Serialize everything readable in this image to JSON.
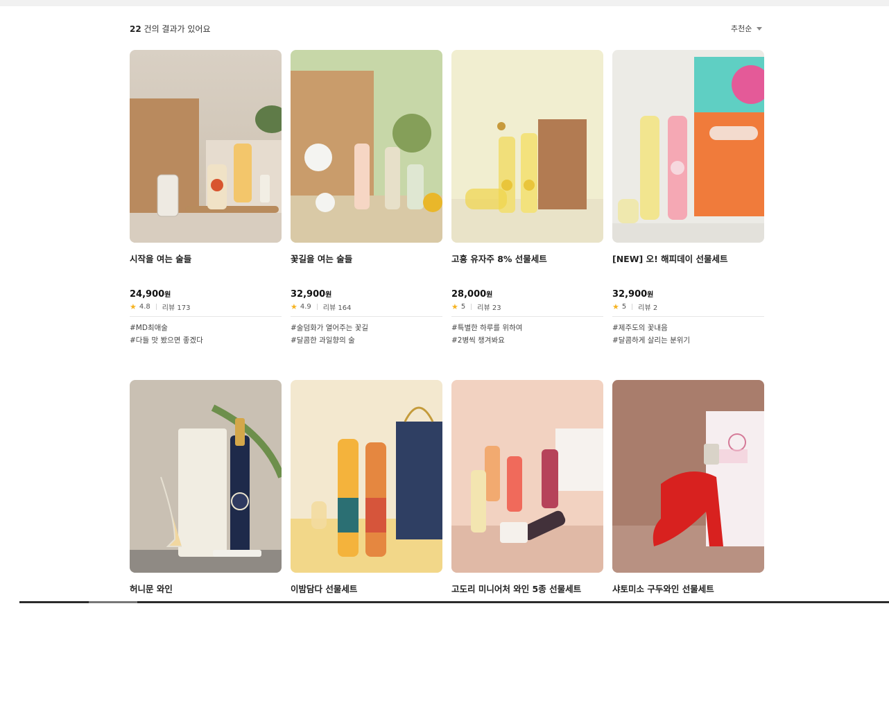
{
  "results": {
    "count": "22",
    "suffix": "건의 결과가 있어요"
  },
  "sort": {
    "label": "추천순"
  },
  "products": [
    {
      "name": "시작을 여는 술들",
      "price": "24,900",
      "currency": "원",
      "rating": "4.8",
      "reviews": "리뷰 173",
      "tags": [
        "#MD최애술",
        "#다들 맛 봤으면 좋겠다"
      ]
    },
    {
      "name": "꽃길을 여는 술들",
      "price": "32,900",
      "currency": "원",
      "rating": "4.9",
      "reviews": "리뷰 164",
      "tags": [
        "#술덤화가 열어주는 꽃길",
        "#달콤한 과일향의 술"
      ]
    },
    {
      "name": "고흥 유자주 8% 선물세트",
      "price": "28,000",
      "currency": "원",
      "rating": "5",
      "reviews": "리뷰 23",
      "tags": [
        "#특별한 하루를 위하여",
        "#2병씩 챙겨봐요"
      ]
    },
    {
      "name": "[NEW] 오! 해피데이 선물세트",
      "price": "32,900",
      "currency": "원",
      "rating": "5",
      "reviews": "리뷰 2",
      "tags": [
        "#제주도의 꽃내음",
        "#달콤하게 살리는 분위기"
      ]
    },
    {
      "name": "허니문 와인"
    },
    {
      "name": "이밤담다 선물세트"
    },
    {
      "name": "고도리 미니어처 와인 5종 선물세트"
    },
    {
      "name": "샤토미소 구두와인 선물세트"
    }
  ],
  "icons": {
    "star": "star-icon",
    "sort_caret": "caret-down-icon"
  },
  "colors": {
    "star": "#f6b321"
  }
}
